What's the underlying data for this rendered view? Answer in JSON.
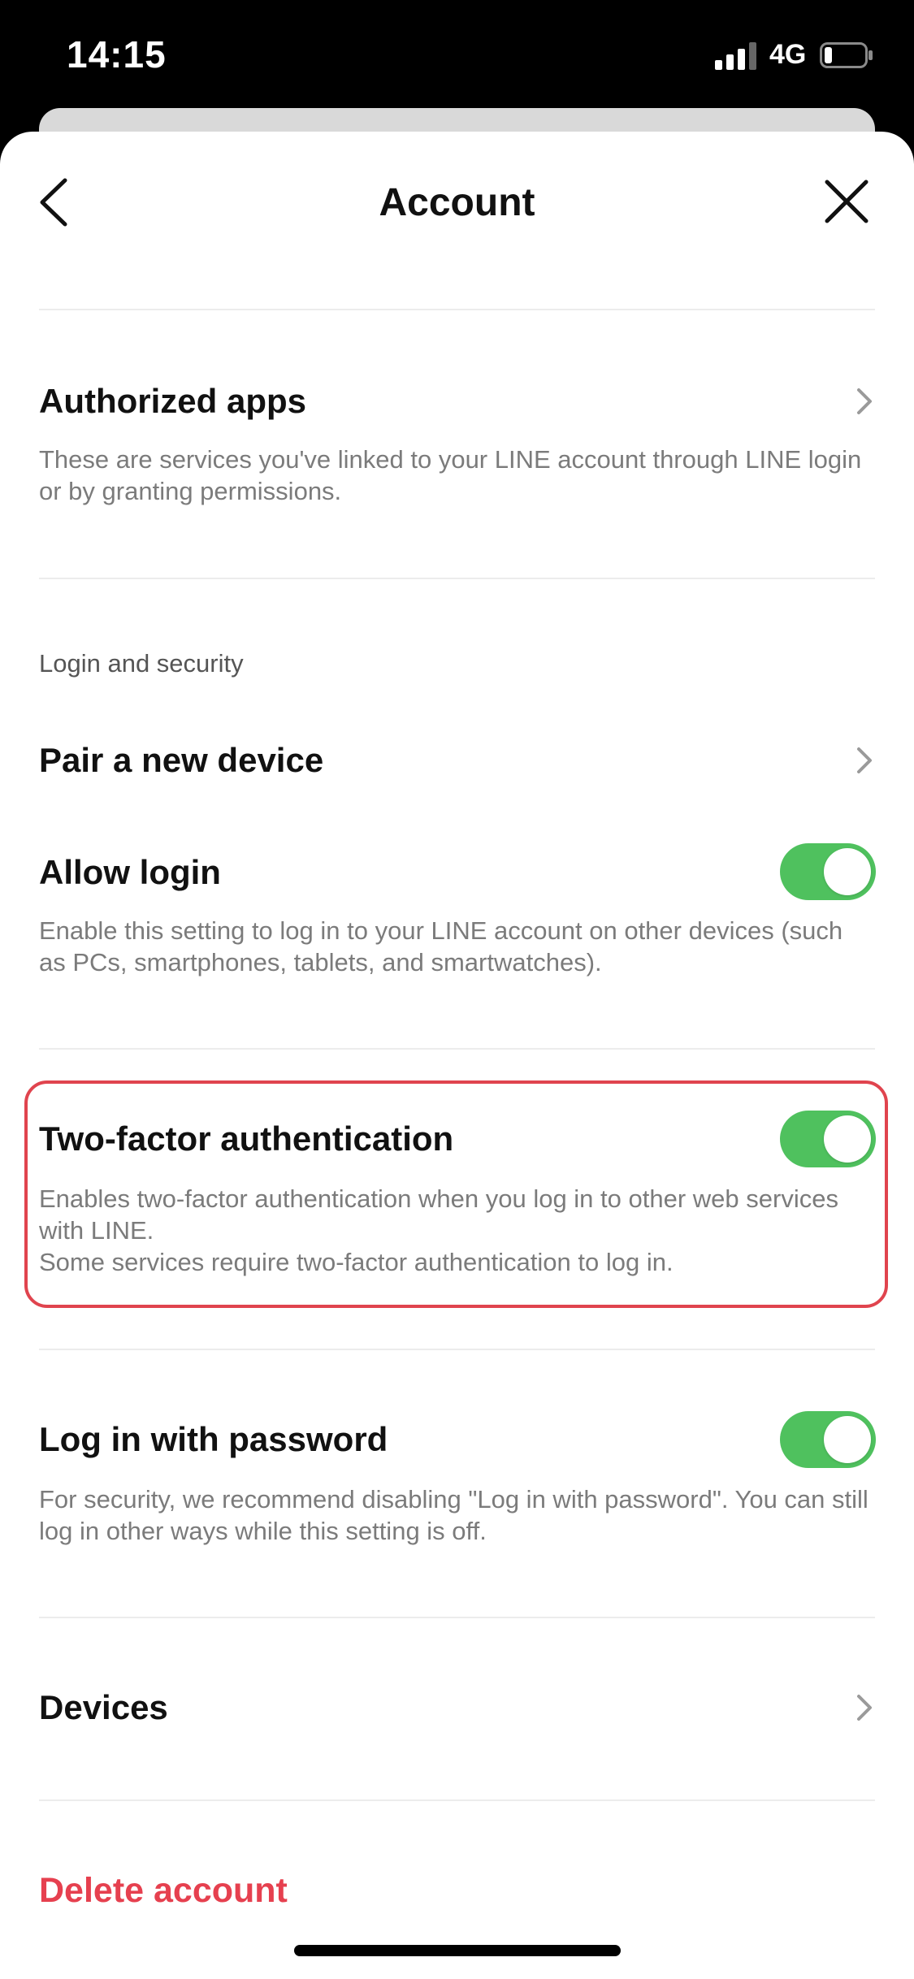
{
  "status_bar": {
    "time": "14:15",
    "network": "4G"
  },
  "header": {
    "title": "Account"
  },
  "authorized_apps": {
    "title": "Authorized apps",
    "description": "These are services you've linked to your LINE account through LINE login or by granting permissions."
  },
  "section_login": {
    "label": "Login and security"
  },
  "pair_device": {
    "title": "Pair a new device"
  },
  "allow_login": {
    "title": "Allow login",
    "description": "Enable this setting to log in to your LINE account on other devices (such as PCs, smartphones, tablets, and smartwatches).",
    "enabled": true
  },
  "two_factor": {
    "title": "Two-factor authentication",
    "description_line1": "Enables two-factor authentication when you log in to other web services with LINE.",
    "description_line2": "Some services require two-factor authentication to log in.",
    "enabled": true
  },
  "password_login": {
    "title": "Log in with password",
    "description": "For security, we recommend disabling \"Log in with password\". You can still log in other ways while this setting is off.",
    "enabled": true
  },
  "devices": {
    "title": "Devices"
  },
  "delete_account": {
    "label": "Delete account"
  },
  "colors": {
    "toggle_on": "#4fc15e",
    "danger": "#e6404f",
    "highlight": "#e0444e"
  }
}
